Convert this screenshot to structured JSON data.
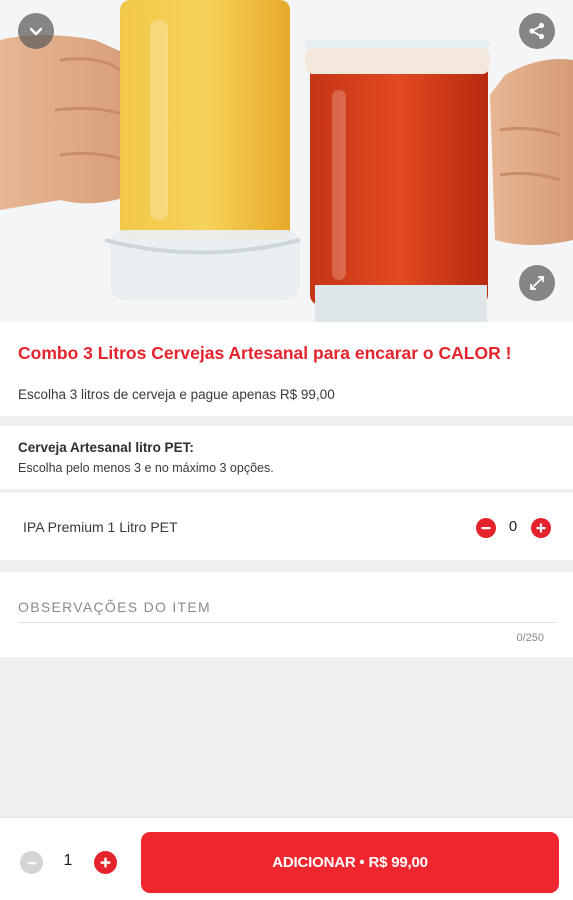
{
  "hero": {
    "image_name": "beer-mugs-toast-image",
    "collapse_icon": "chevron-down-icon",
    "share_icon": "share-icon",
    "expand_icon": "expand-icon"
  },
  "product": {
    "title": "Combo 3 Litros Cervejas Artesanal para encarar o CALOR !",
    "description": "Escolha 3 litros de cerveja e pague apenas R$ 99,00"
  },
  "option_group": {
    "title": "Cerveja Artesanal litro PET:",
    "subtitle": "Escolha pelo menos 3 e no máximo 3 opções.",
    "options": [
      {
        "label": "IPA Premium 1 Litro PET",
        "quantity": "0"
      }
    ]
  },
  "notes": {
    "placeholder": "OBSERVAÇÕES DO ITEM",
    "value": "",
    "counter": "0/250"
  },
  "footer": {
    "quantity": "1",
    "add_button_label": "ADICIONAR • R$ 99,00"
  },
  "colors": {
    "accent": "#e5232c",
    "button": "#f0262f",
    "disabled": "#d4d4d4",
    "divider": "#efefef"
  }
}
